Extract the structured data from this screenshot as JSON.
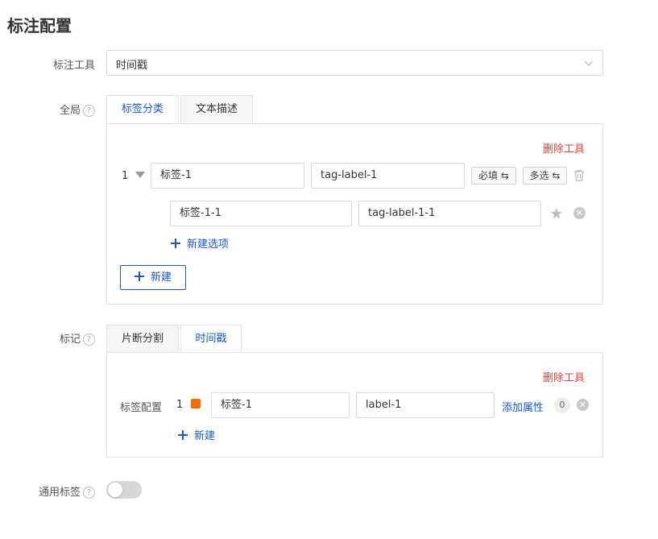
{
  "page": {
    "title": "标注配置"
  },
  "tool_field": {
    "label": "标注工具",
    "value": "时间戳"
  },
  "global": {
    "label": "全局",
    "help": "?",
    "tabs": [
      {
        "label": "标签分类",
        "active": true
      },
      {
        "label": "文本描述",
        "active": false
      }
    ],
    "delete_label": "删除工具",
    "row": {
      "index": "1",
      "name": "标签-1",
      "key": "tag-label-1",
      "required_label": "必填 ⇆",
      "multi_label": "多选 ⇆",
      "option": {
        "name": "标签-1-1",
        "key": "tag-label-1-1"
      }
    },
    "new_option_label": "新建选项",
    "new_label": "新建"
  },
  "mark": {
    "label": "标记",
    "help": "?",
    "tabs": [
      {
        "label": "片断分割",
        "active": false
      },
      {
        "label": "时间戳",
        "active": true
      }
    ],
    "delete_label": "删除工具",
    "tag_config_label": "标签配置",
    "row": {
      "index": "1",
      "color": "#f56a00",
      "name": "标签-1",
      "key": "label-1",
      "add_attr_label": "添加属性",
      "attr_count": "0"
    },
    "new_label": "新建"
  },
  "common": {
    "label": "通用标签",
    "help": "?",
    "enabled": false
  },
  "colors": {
    "accent": "#1a57c9",
    "danger": "#e3423d",
    "tag_color": "#f56a00"
  }
}
